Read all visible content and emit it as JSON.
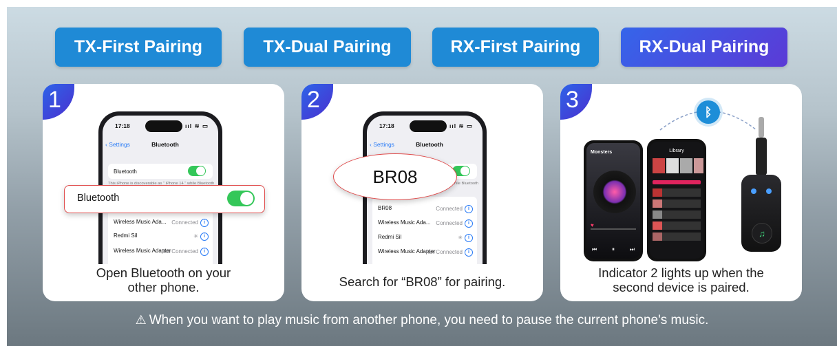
{
  "tabs": [
    {
      "label": "TX-First Pairing",
      "active": false
    },
    {
      "label": "TX-Dual Pairing",
      "active": false
    },
    {
      "label": "RX-First Pairing",
      "active": false
    },
    {
      "label": "RX-Dual Pairing",
      "active": true
    }
  ],
  "steps": [
    {
      "number": "1",
      "caption_line1": "Open Bluetooth on your",
      "caption_line2": "other phone.",
      "phone": {
        "time": "17:18",
        "back_label": "Settings",
        "title": "Bluetooth",
        "bluetooth_row": "Bluetooth",
        "discoverable_text": "This iPhone is discoverable as \" iPhone 14 \" while Bluetooth",
        "highlight_label": "Bluetooth",
        "devices": [
          {
            "name": "Wireless Music Ada...",
            "status": "Connected"
          },
          {
            "name": "Redmi Sil",
            "status": ""
          },
          {
            "name": "Wireless Music Adapter",
            "status": "Not Connected"
          }
        ]
      }
    },
    {
      "number": "2",
      "caption_line1": "Search for “BR08” for pairing.",
      "phone": {
        "time": "17:18",
        "back_label": "Settings",
        "title": "Bluetooth",
        "discoverable_tail": "while Bluetooth",
        "highlight_label": "BR08",
        "devices": [
          {
            "name": "BR08",
            "status": "Connected"
          },
          {
            "name": "Wireless Music Ada...",
            "status": "Connected"
          },
          {
            "name": "Redmi Sil",
            "status": ""
          },
          {
            "name": "Wireless Music Adapter",
            "status": "Not Connected"
          }
        ]
      }
    },
    {
      "number": "3",
      "caption_line1": "Indicator 2 lights up when the",
      "caption_line2": "second device is paired.",
      "player_title": "Monsters",
      "library_title": "Library"
    }
  ],
  "footer_note": "When you want to play music from another phone, you need to pause the current phone's music.",
  "colors": {
    "tab": "#1f8ad6",
    "tab_active_start": "#3565ea",
    "tab_active_end": "#5b3ad6",
    "toggle_on": "#34c759",
    "highlight_border": "#e04b4b",
    "ios_blue": "#2b7cf6"
  }
}
